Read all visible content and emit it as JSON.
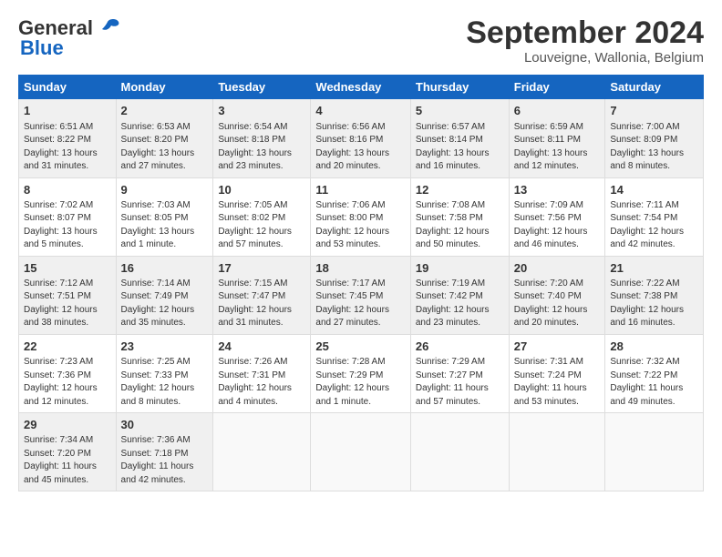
{
  "logo": {
    "part1": "General",
    "part2": "Blue"
  },
  "header": {
    "month": "September 2024",
    "location": "Louveigne, Wallonia, Belgium"
  },
  "weekdays": [
    "Sunday",
    "Monday",
    "Tuesday",
    "Wednesday",
    "Thursday",
    "Friday",
    "Saturday"
  ],
  "weeks": [
    [
      {
        "day": "1",
        "info": "Sunrise: 6:51 AM\nSunset: 8:22 PM\nDaylight: 13 hours\nand 31 minutes."
      },
      {
        "day": "2",
        "info": "Sunrise: 6:53 AM\nSunset: 8:20 PM\nDaylight: 13 hours\nand 27 minutes."
      },
      {
        "day": "3",
        "info": "Sunrise: 6:54 AM\nSunset: 8:18 PM\nDaylight: 13 hours\nand 23 minutes."
      },
      {
        "day": "4",
        "info": "Sunrise: 6:56 AM\nSunset: 8:16 PM\nDaylight: 13 hours\nand 20 minutes."
      },
      {
        "day": "5",
        "info": "Sunrise: 6:57 AM\nSunset: 8:14 PM\nDaylight: 13 hours\nand 16 minutes."
      },
      {
        "day": "6",
        "info": "Sunrise: 6:59 AM\nSunset: 8:11 PM\nDaylight: 13 hours\nand 12 minutes."
      },
      {
        "day": "7",
        "info": "Sunrise: 7:00 AM\nSunset: 8:09 PM\nDaylight: 13 hours\nand 8 minutes."
      }
    ],
    [
      {
        "day": "8",
        "info": "Sunrise: 7:02 AM\nSunset: 8:07 PM\nDaylight: 13 hours\nand 5 minutes."
      },
      {
        "day": "9",
        "info": "Sunrise: 7:03 AM\nSunset: 8:05 PM\nDaylight: 13 hours\nand 1 minute."
      },
      {
        "day": "10",
        "info": "Sunrise: 7:05 AM\nSunset: 8:02 PM\nDaylight: 12 hours\nand 57 minutes."
      },
      {
        "day": "11",
        "info": "Sunrise: 7:06 AM\nSunset: 8:00 PM\nDaylight: 12 hours\nand 53 minutes."
      },
      {
        "day": "12",
        "info": "Sunrise: 7:08 AM\nSunset: 7:58 PM\nDaylight: 12 hours\nand 50 minutes."
      },
      {
        "day": "13",
        "info": "Sunrise: 7:09 AM\nSunset: 7:56 PM\nDaylight: 12 hours\nand 46 minutes."
      },
      {
        "day": "14",
        "info": "Sunrise: 7:11 AM\nSunset: 7:54 PM\nDaylight: 12 hours\nand 42 minutes."
      }
    ],
    [
      {
        "day": "15",
        "info": "Sunrise: 7:12 AM\nSunset: 7:51 PM\nDaylight: 12 hours\nand 38 minutes."
      },
      {
        "day": "16",
        "info": "Sunrise: 7:14 AM\nSunset: 7:49 PM\nDaylight: 12 hours\nand 35 minutes."
      },
      {
        "day": "17",
        "info": "Sunrise: 7:15 AM\nSunset: 7:47 PM\nDaylight: 12 hours\nand 31 minutes."
      },
      {
        "day": "18",
        "info": "Sunrise: 7:17 AM\nSunset: 7:45 PM\nDaylight: 12 hours\nand 27 minutes."
      },
      {
        "day": "19",
        "info": "Sunrise: 7:19 AM\nSunset: 7:42 PM\nDaylight: 12 hours\nand 23 minutes."
      },
      {
        "day": "20",
        "info": "Sunrise: 7:20 AM\nSunset: 7:40 PM\nDaylight: 12 hours\nand 20 minutes."
      },
      {
        "day": "21",
        "info": "Sunrise: 7:22 AM\nSunset: 7:38 PM\nDaylight: 12 hours\nand 16 minutes."
      }
    ],
    [
      {
        "day": "22",
        "info": "Sunrise: 7:23 AM\nSunset: 7:36 PM\nDaylight: 12 hours\nand 12 minutes."
      },
      {
        "day": "23",
        "info": "Sunrise: 7:25 AM\nSunset: 7:33 PM\nDaylight: 12 hours\nand 8 minutes."
      },
      {
        "day": "24",
        "info": "Sunrise: 7:26 AM\nSunset: 7:31 PM\nDaylight: 12 hours\nand 4 minutes."
      },
      {
        "day": "25",
        "info": "Sunrise: 7:28 AM\nSunset: 7:29 PM\nDaylight: 12 hours\nand 1 minute."
      },
      {
        "day": "26",
        "info": "Sunrise: 7:29 AM\nSunset: 7:27 PM\nDaylight: 11 hours\nand 57 minutes."
      },
      {
        "day": "27",
        "info": "Sunrise: 7:31 AM\nSunset: 7:24 PM\nDaylight: 11 hours\nand 53 minutes."
      },
      {
        "day": "28",
        "info": "Sunrise: 7:32 AM\nSunset: 7:22 PM\nDaylight: 11 hours\nand 49 minutes."
      }
    ],
    [
      {
        "day": "29",
        "info": "Sunrise: 7:34 AM\nSunset: 7:20 PM\nDaylight: 11 hours\nand 45 minutes."
      },
      {
        "day": "30",
        "info": "Sunrise: 7:36 AM\nSunset: 7:18 PM\nDaylight: 11 hours\nand 42 minutes."
      },
      {
        "day": "",
        "info": ""
      },
      {
        "day": "",
        "info": ""
      },
      {
        "day": "",
        "info": ""
      },
      {
        "day": "",
        "info": ""
      },
      {
        "day": "",
        "info": ""
      }
    ]
  ]
}
